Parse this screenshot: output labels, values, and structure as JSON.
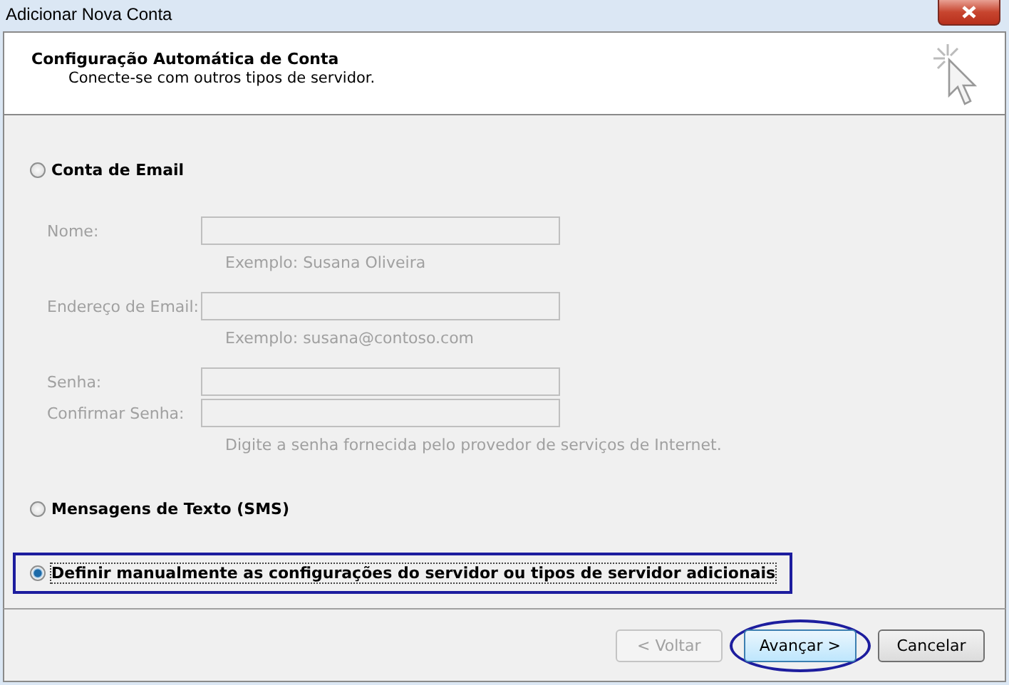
{
  "window": {
    "title": "Adicionar Nova Conta"
  },
  "header": {
    "title": "Configuração Automática de Conta",
    "subtitle": "Conecte-se com outros tipos de servidor."
  },
  "options": [
    {
      "kind": "email",
      "label": "Conta de Email",
      "selected": false,
      "highlighted": false,
      "disabled": true,
      "fields": [
        {
          "label": "Nome:",
          "hint": "Exemplo: Susana Oliveira"
        },
        {
          "label": "Endereço de Email:",
          "hint": "Exemplo: susana@contoso.com"
        },
        {
          "label": "Senha:"
        },
        {
          "label": "Confirmar Senha:",
          "hint": "Digite a senha fornecida pelo provedor de serviços de Internet."
        }
      ]
    },
    {
      "kind": "plain",
      "label": "Mensagens de Texto (SMS)",
      "selected": false,
      "highlighted": false
    },
    {
      "kind": "plain",
      "label": "Definir manualmente as configurações do servidor ou tipos de servidor adicionais",
      "selected": true,
      "highlighted": true
    }
  ],
  "buttons": [
    {
      "label": "< Voltar",
      "disabled": true,
      "circled": false
    },
    {
      "label": "Avançar >",
      "disabled": false,
      "circled": true
    },
    {
      "label": "Cancelar",
      "disabled": false,
      "circled": false
    }
  ]
}
